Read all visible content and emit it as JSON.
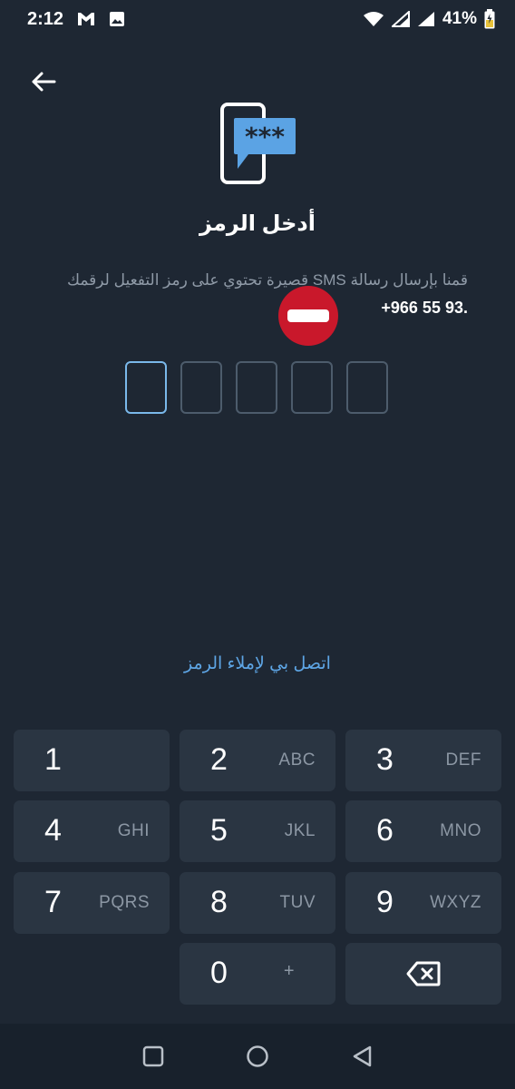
{
  "status_bar": {
    "time": "2:12",
    "battery_percent": "41%",
    "icons": [
      "gmail-icon",
      "image-icon",
      "wifi-icon",
      "signal-icon",
      "signal-icon",
      "battery-icon"
    ]
  },
  "header": {
    "title": "أدخل الرمز",
    "instruction_text": "قمنا بإرسال رسالة SMS قصيرة تحتوي على رمز التفعيل لرقمك",
    "phone_number": "+966 55 93",
    "phone_suffix": "."
  },
  "code_input": {
    "length": 5,
    "active_index": 0
  },
  "call_me_link": "اتصل بي لإملاء الرمز",
  "keypad": {
    "keys": [
      {
        "digit": "1",
        "letters": ""
      },
      {
        "digit": "2",
        "letters": "ABC"
      },
      {
        "digit": "3",
        "letters": "DEF"
      },
      {
        "digit": "4",
        "letters": "GHI"
      },
      {
        "digit": "5",
        "letters": "JKL"
      },
      {
        "digit": "6",
        "letters": "MNO"
      },
      {
        "digit": "7",
        "letters": "PQRS"
      },
      {
        "digit": "8",
        "letters": "TUV"
      },
      {
        "digit": "9",
        "letters": "WXYZ"
      },
      {
        "digit": "0",
        "letters": "+"
      }
    ],
    "backspace_icon": "backspace-icon"
  },
  "colors": {
    "background": "#1e2733",
    "key_background": "#2a3542",
    "accent": "#5ea6e6",
    "no_entry_red": "#c9182b"
  },
  "nav_bar": {
    "icons": [
      "recents-square-icon",
      "home-circle-icon",
      "back-triangle-icon"
    ]
  }
}
